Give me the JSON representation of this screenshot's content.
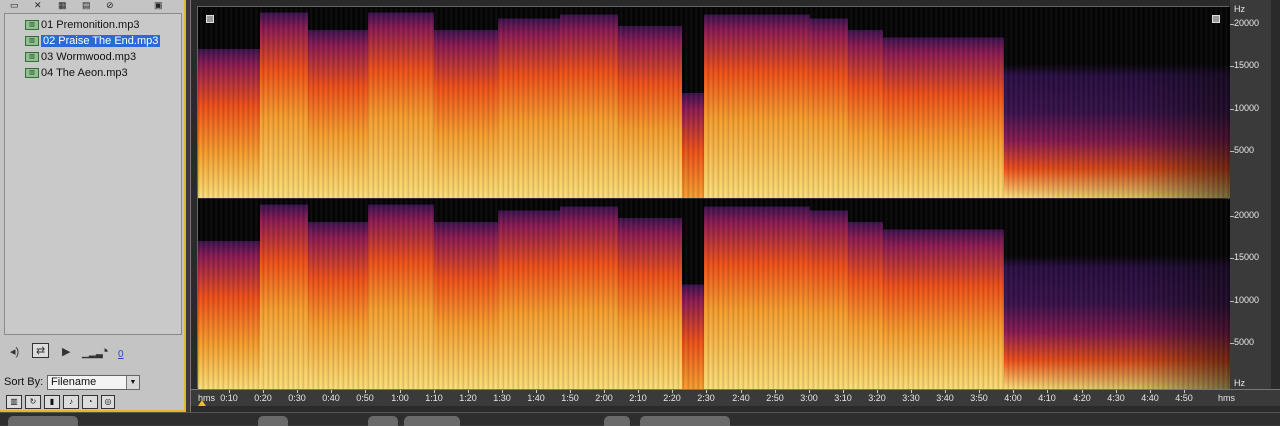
{
  "files": {
    "items": [
      {
        "label": "01 Premonition.mp3",
        "selected": false
      },
      {
        "label": "02 Praise The End.mp3",
        "selected": true
      },
      {
        "label": "03 Wormwood.mp3",
        "selected": false
      },
      {
        "label": "04 The Aeon.mp3",
        "selected": false
      }
    ],
    "volume_value": "0",
    "sort_by_label": "Sort By:",
    "sort_by_value": "Filename"
  },
  "spectral": {
    "hz_unit": "Hz",
    "freq_labels": [
      "20000",
      "15000",
      "10000",
      "5000"
    ],
    "time_unit_left": "hms",
    "time_unit_right": "hms",
    "time_labels": [
      "0:10",
      "0:20",
      "0:30",
      "0:40",
      "0:50",
      "1:00",
      "1:10",
      "1:20",
      "1:30",
      "1:40",
      "1:50",
      "2:00",
      "2:10",
      "2:20",
      "2:30",
      "2:40",
      "2:50",
      "3:00",
      "3:10",
      "3:20",
      "3:30",
      "3:40",
      "3:50",
      "4:00",
      "4:10",
      "4:20",
      "4:30",
      "4:40",
      "4:50"
    ],
    "colors": {
      "low": "#fde07a",
      "mid": "#f0501a",
      "high": "#8a1a55",
      "top": "#3a1250",
      "bg": "#050508"
    }
  }
}
